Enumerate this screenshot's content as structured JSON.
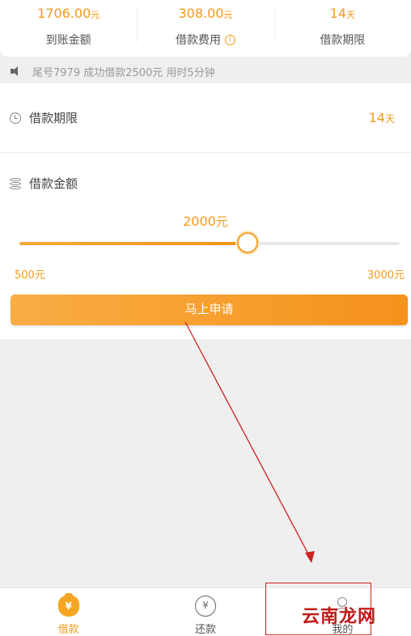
{
  "summary": {
    "received": {
      "value": "1706.00",
      "unit": "元",
      "label": "到账金额"
    },
    "fee": {
      "value": "308.00",
      "unit": "元",
      "label": "借款费用"
    },
    "term": {
      "value": "14",
      "unit": "天",
      "label": "借款期限"
    }
  },
  "notice": {
    "text": "尾号7979 成功借款2500元 用时5分钟"
  },
  "loan_term": {
    "label": "借款期限",
    "value": "14",
    "unit": "天"
  },
  "loan_amount": {
    "label": "借款金额",
    "value": "2000",
    "unit": "元",
    "slider": {
      "min": 500,
      "max": 3000,
      "value": 2000
    },
    "min_label": "500元",
    "max_label": "3000元"
  },
  "apply_button": {
    "label": "马上申请"
  },
  "tabbar": {
    "tabs": [
      {
        "label": "借款",
        "icon": "money-bag-icon",
        "active": true
      },
      {
        "label": "还款",
        "icon": "yen-circle-icon",
        "active": false
      },
      {
        "label": "我的",
        "icon": "user-icon",
        "active": false
      }
    ]
  },
  "overlay": {
    "watermark": "云南龙网",
    "annotation_color": "#cc2222"
  },
  "colors": {
    "accent": "#f39a1c",
    "background": "#efefef"
  }
}
